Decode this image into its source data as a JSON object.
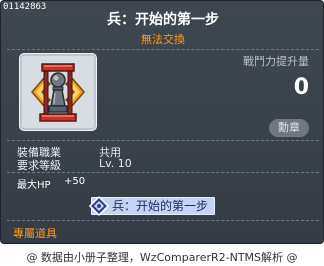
{
  "item": {
    "id": "01142863",
    "name": "兵：开始的第一步",
    "trade_status": "無法交換",
    "power_label": "戰鬥力提升量",
    "power_value": "0",
    "medal_button": "勳章",
    "icon": "pawn-chess-medal-icon",
    "stats": {
      "job_label": "裝備職業",
      "job_value": "共用",
      "level_label": "要求等級",
      "level_value": "Lv. 10"
    },
    "bonus": {
      "label": "最大HP",
      "value": "+50"
    },
    "skill_chip_label": "兵：开始的第一步",
    "exclusive_label": "專屬道具"
  },
  "footer": {
    "credit": "@ 数据由小册子整理，WzComparerR2-NTMS解析 @"
  },
  "colors": {
    "background": "#3a424c",
    "accent_orange": "#ff9b1b",
    "chip_bg": "#c5d3f2"
  }
}
